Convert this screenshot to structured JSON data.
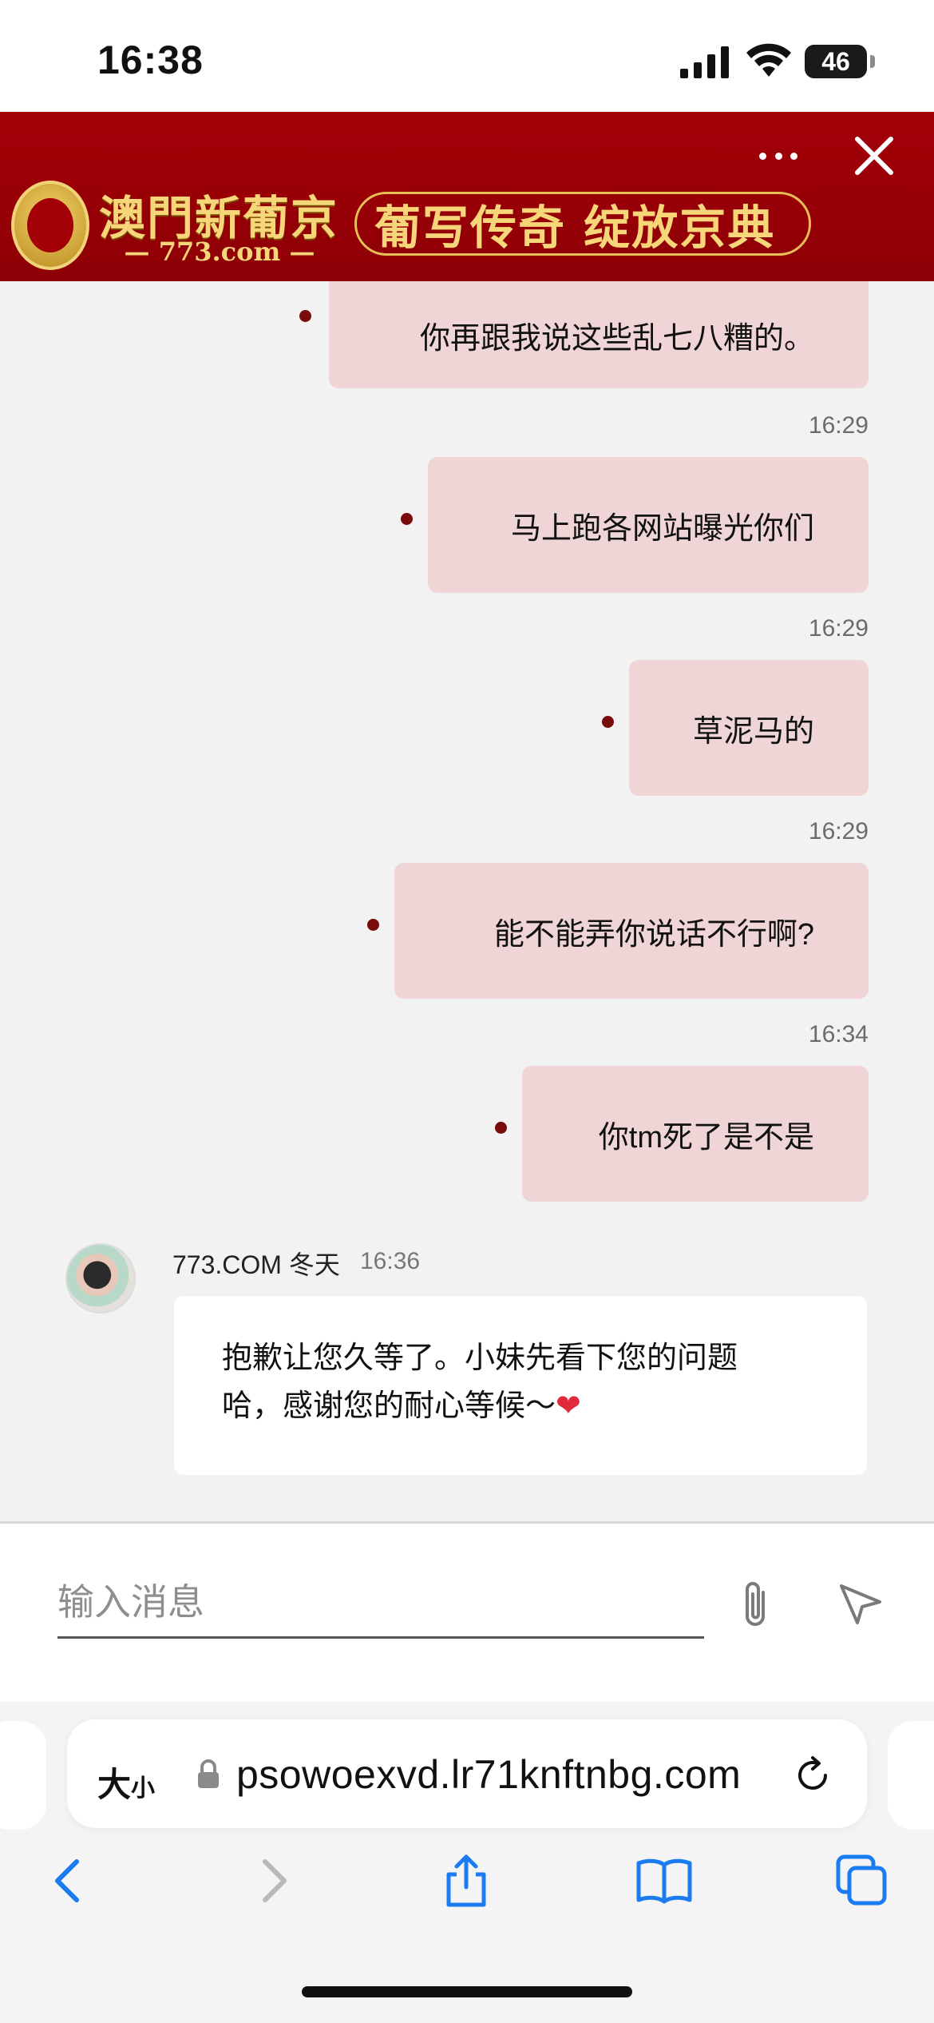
{
  "status_bar": {
    "time": "16:38",
    "battery": "46"
  },
  "banner": {
    "brand": "澳門新葡京",
    "domain": "773.com",
    "slogan": "葡写传奇 绽放京典",
    "colors": {
      "background": "#a40007",
      "gold": "#f6d679"
    }
  },
  "chat": {
    "messages_out": [
      {
        "text": "你再跟我说这些乱七八糟的。"
      },
      {
        "time": "16:29",
        "text": "马上跑各网站曝光你们"
      },
      {
        "time": "16:29",
        "text": "草泥马的"
      },
      {
        "time": "16:29",
        "text": "能不能弄你说话不行啊?"
      },
      {
        "time": "16:34",
        "text": "你tm死了是不是"
      }
    ],
    "agent": {
      "name": "773.COM 冬天",
      "time": "16:36",
      "message_line1": "抱歉让您久等了。小妹先看下您的问题",
      "message_line2": "哈，感谢您的耐心等候～",
      "emoji": "❤"
    },
    "colors": {
      "bubble_out": "#efd5d6",
      "dot": "#7a0b0b"
    }
  },
  "input": {
    "placeholder": "输入消息",
    "value": ""
  },
  "browser": {
    "text_size_label": "大",
    "text_size_label_small": "小",
    "url": "psowoexvd.lr71knftnbg.com",
    "accent": "#1a7cf0"
  },
  "icons": [
    "more-icon",
    "close-icon",
    "attach-icon",
    "send-icon",
    "lock-icon",
    "reload-icon",
    "back-icon",
    "forward-icon",
    "share-icon",
    "bookmarks-icon",
    "tabs-icon"
  ]
}
